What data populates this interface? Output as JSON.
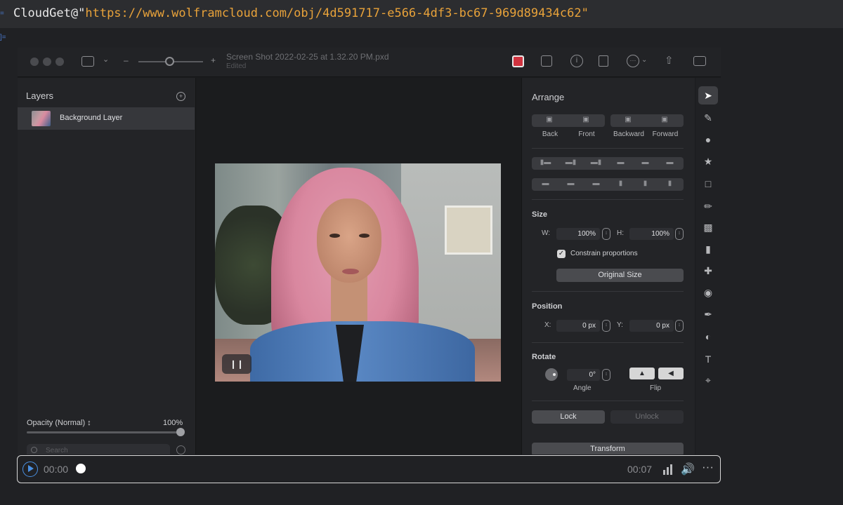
{
  "notebook": {
    "code_prefix": "CloudGet@\"",
    "code_url": "https://www.wolframcloud.com/obj/4d591717-e566-4df3-bc67-969d89434c62",
    "code_suffix": "\""
  },
  "app": {
    "title": "Screen Shot 2022-02-25 at 1.32.20 PM.pxd",
    "subtitle": "Edited",
    "icons": [
      "sidebar-toggle-icon",
      "chevron-down-icon",
      "zoom-out-icon",
      "zoom-in-icon",
      "color-icon",
      "portrait-icon",
      "info-icon",
      "rotate-icon",
      "more-icon",
      "share-icon",
      "panel-icon"
    ]
  },
  "layers": {
    "title": "Layers",
    "items": [
      {
        "name": "Background Layer"
      }
    ],
    "opacity_label": "Opacity (Normal) ↕",
    "opacity_value": "100%",
    "opacity_fraction": 1.0,
    "search_placeholder": "Search"
  },
  "arrange": {
    "title": "Arrange",
    "order_buttons": [
      {
        "label": "Back",
        "icon": "back-icon"
      },
      {
        "label": "Front",
        "icon": "front-icon"
      },
      {
        "label": "Backward",
        "icon": "backward-icon"
      },
      {
        "label": "Forward",
        "icon": "forward-icon"
      }
    ],
    "size": {
      "title": "Size",
      "w_label": "W:",
      "w_value": "100%",
      "h_label": "H:",
      "h_value": "100%",
      "constrain_label": "Constrain proportions",
      "constrain_checked": true,
      "original_size_label": "Original Size"
    },
    "position": {
      "title": "Position",
      "x_label": "X:",
      "x_value": "0 px",
      "y_label": "Y:",
      "y_value": "0 px"
    },
    "rotate": {
      "title": "Rotate",
      "angle_value": "0°",
      "angle_label": "Angle",
      "flip_label": "Flip"
    },
    "lock_label": "Lock",
    "unlock_label": "Unlock",
    "transform_label": "Transform"
  },
  "tools": [
    "arrow-icon",
    "style-icon",
    "color-adjust-icon",
    "effects-icon",
    "selection-icon",
    "brush-icon",
    "fill-icon",
    "eraser-icon",
    "bandage-icon",
    "clone-icon",
    "pen-icon",
    "shape-icon",
    "text-icon",
    "crop-icon"
  ],
  "media": {
    "current_time": "00:00",
    "total_time": "00:07",
    "progress_fraction": 0.0
  },
  "colors": {
    "accent": "#4a90e2",
    "string": "#e8a23a",
    "record": "#d0333f"
  }
}
